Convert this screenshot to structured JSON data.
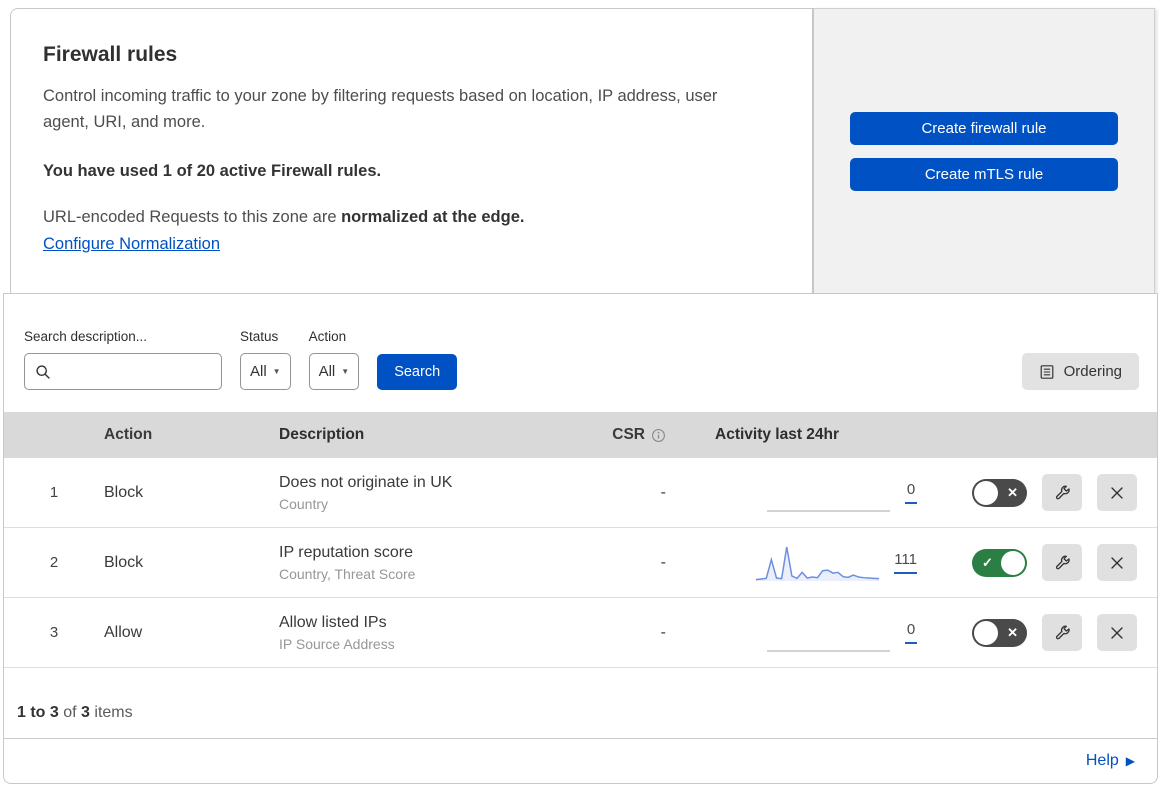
{
  "header": {
    "title": "Firewall rules",
    "description": "Control incoming traffic to your zone by filtering requests based on location, IP address, user agent, URI, and more.",
    "usage": "You have used 1 of 20 active Firewall rules.",
    "normalization_prefix": "URL-encoded Requests to this zone are ",
    "normalization_bold": "normalized at the edge.",
    "normalization_link": "Configure Normalization",
    "buttons": [
      {
        "label": "Create firewall rule"
      },
      {
        "label": "Create mTLS rule"
      }
    ]
  },
  "filters": {
    "search_label": "Search description...",
    "search_value": "",
    "status_label": "Status",
    "status_value": "All",
    "action_label": "Action",
    "action_value": "All",
    "search_button": "Search",
    "ordering_button": "Ordering"
  },
  "table": {
    "columns": {
      "action": "Action",
      "description": "Description",
      "csr": "CSR",
      "activity": "Activity last 24hr"
    },
    "rows": [
      {
        "priority": "1",
        "action": "Block",
        "description": "Does not originate in UK",
        "criteria": "Country",
        "csr": "-",
        "activity_count": "0",
        "enabled": false,
        "sparkline": [
          0,
          0,
          0,
          0,
          0,
          0,
          0,
          0,
          0,
          0,
          0,
          0,
          0,
          0,
          0,
          0,
          0,
          0,
          0,
          0,
          0,
          0,
          0,
          0,
          0
        ]
      },
      {
        "priority": "2",
        "action": "Block",
        "description": "IP reputation score",
        "criteria": "Country, Threat Score",
        "csr": "-",
        "activity_count": "111",
        "enabled": true,
        "sparkline": [
          1,
          3,
          5,
          62,
          6,
          4,
          100,
          12,
          5,
          23,
          6,
          9,
          7,
          28,
          30,
          21,
          23,
          10,
          8,
          15,
          9,
          7,
          6,
          5,
          4
        ]
      },
      {
        "priority": "3",
        "action": "Allow",
        "description": "Allow listed IPs",
        "criteria": "IP Source Address",
        "csr": "-",
        "activity_count": "0",
        "enabled": false,
        "sparkline": [
          0,
          0,
          0,
          0,
          0,
          0,
          0,
          0,
          0,
          0,
          0,
          0,
          0,
          0,
          0,
          0,
          0,
          0,
          0,
          0,
          0,
          0,
          0,
          0,
          0
        ]
      }
    ]
  },
  "footer": {
    "items_range": "1 to 3",
    "items_of": " of ",
    "items_total": "3",
    "items_suffix": " items",
    "help_label": "Help"
  },
  "icons": {
    "dropdown_arrow": "▼",
    "help_arrow": "▶",
    "toggle_on_mark": "✓",
    "toggle_off_mark": "✕",
    "search_icon": "magnifier",
    "ordering_icon": "list-document",
    "info_icon": "info-circle",
    "wrench_icon": "wrench",
    "delete_icon": "x-cross"
  },
  "colors": {
    "accent_blue": "#0051c3",
    "toggle_on_green": "#2b7e44",
    "toggle_off_gray": "#4a4a4a",
    "spark_line_blue": "#6d8fe0",
    "spark_fill_blue": "rgba(109,143,224,0.14)",
    "spark_flat_gray": "#c4c4c4",
    "table_header_bg": "#d9d9d9",
    "side_panel_bg": "#f1f1f1"
  }
}
